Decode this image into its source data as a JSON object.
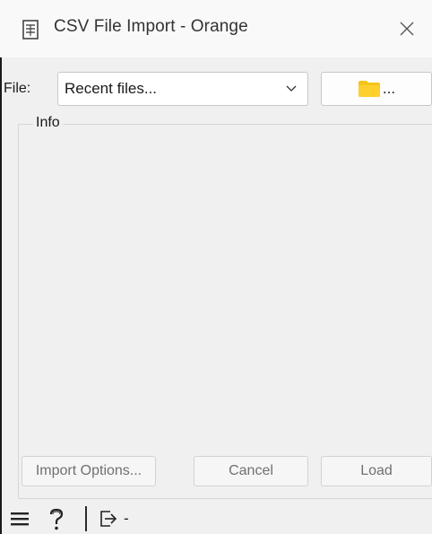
{
  "window": {
    "title": "CSV File Import - Orange"
  },
  "file_row": {
    "label": "File:",
    "combo_value": "Recent files...",
    "browse_label": "..."
  },
  "info": {
    "title": "Info"
  },
  "buttons": {
    "import_options": "Import Options...",
    "cancel": "Cancel",
    "load": "Load"
  },
  "statusbar": {
    "output_text": "-"
  },
  "icons": {
    "title": "document-icon",
    "close": "close-icon",
    "combo": "chevron-down-icon",
    "browse": "folder-icon",
    "menu": "menu-icon",
    "help": "help-icon",
    "output": "output-icon"
  },
  "colors": {
    "folder": "#f5c518",
    "background": "#f0f0f0",
    "disabled_text": "#707070"
  }
}
